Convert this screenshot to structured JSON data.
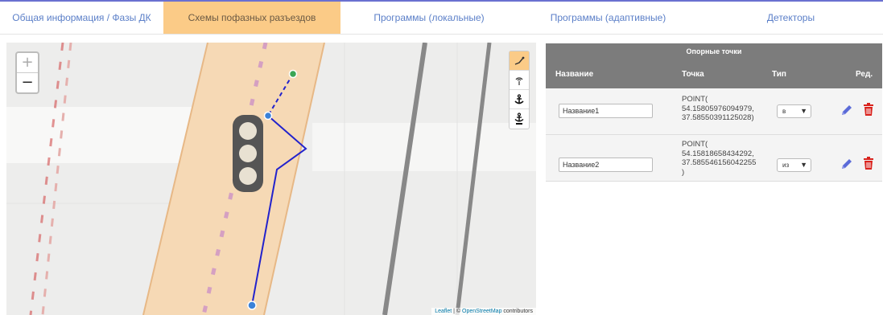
{
  "tabs": [
    {
      "label": "Общая информация / Фазы ДК"
    },
    {
      "label": "Схемы пофазных разъездов"
    },
    {
      "label": "Программы (локальные)"
    },
    {
      "label": "Программы (адаптивные)"
    },
    {
      "label": "Детекторы"
    }
  ],
  "active_tab": 1,
  "map": {
    "zoom_in": "+",
    "zoom_out": "−",
    "attribution_leaflet": "Leaflet",
    "attribution_sep": " | © ",
    "attribution_osm": "OpenStreetMap",
    "attribution_contrib": " contributors"
  },
  "panel": {
    "caption": "Опорные точки",
    "headers": {
      "name": "Название",
      "point": "Точка",
      "type": "Тип",
      "edit": "Ред."
    },
    "rows": [
      {
        "name": "Название1",
        "point": "POINT(\n54.15805976094979,\n37.58550391125028)",
        "type": "в"
      },
      {
        "name": "Название2",
        "point": "POINT(\n54.15818658434292,\n37.585546156042255\n)",
        "type": "из"
      }
    ]
  },
  "colors": {
    "accent": "#fbcb87",
    "link": "#5b7fc8",
    "route": "#2222cc",
    "header_bg": "#7c7c7c",
    "delete": "#d9221c"
  }
}
